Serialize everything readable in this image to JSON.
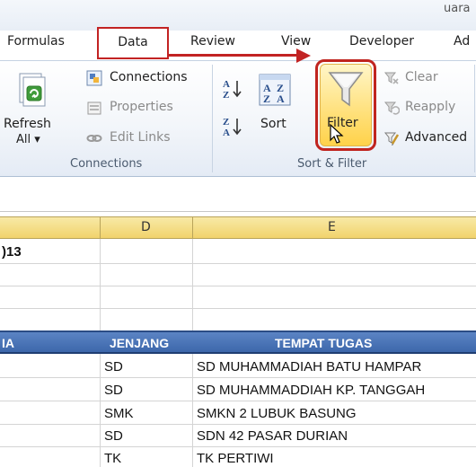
{
  "window": {
    "title_partial": "uara"
  },
  "ribbon_tabs": [
    "Formulas",
    "Data",
    "Review",
    "View",
    "Developer",
    "Ad"
  ],
  "active_tab": "Data",
  "connections_group": {
    "label": "Connections",
    "refresh_label_1": "Refresh",
    "refresh_label_2": "All ▾",
    "connections": "Connections",
    "properties": "Properties",
    "edit_links": "Edit Links"
  },
  "sort_filter_group": {
    "label": "Sort & Filter",
    "sort": "Sort",
    "filter": "Filter",
    "clear": "Clear",
    "reapply": "Reapply",
    "advanced": "Advanced"
  },
  "grid": {
    "columns": [
      "D",
      "E"
    ],
    "year_cell": ")13",
    "header": {
      "partial_col": "IA",
      "jenjang": "JENJANG",
      "tempat_tugas": "TEMPAT TUGAS"
    },
    "rows": [
      {
        "jenjang": "SD",
        "tempat": "SD MUHAMMADIAH BATU HAMPAR"
      },
      {
        "jenjang": "SD",
        "tempat": "SD MUHAMMADDIAH KP. TANGGAH"
      },
      {
        "jenjang": "SMK",
        "tempat": "SMKN 2 LUBUK BASUNG"
      },
      {
        "jenjang": "SD",
        "tempat": "SDN 42 PASAR DURIAN"
      },
      {
        "jenjang": "TK",
        "tempat": "TK PERTIWI"
      }
    ]
  },
  "colors": {
    "highlight_red": "#c22323",
    "table_header_blue": "#3d67ab",
    "column_header_gold": "#f1d36c"
  }
}
